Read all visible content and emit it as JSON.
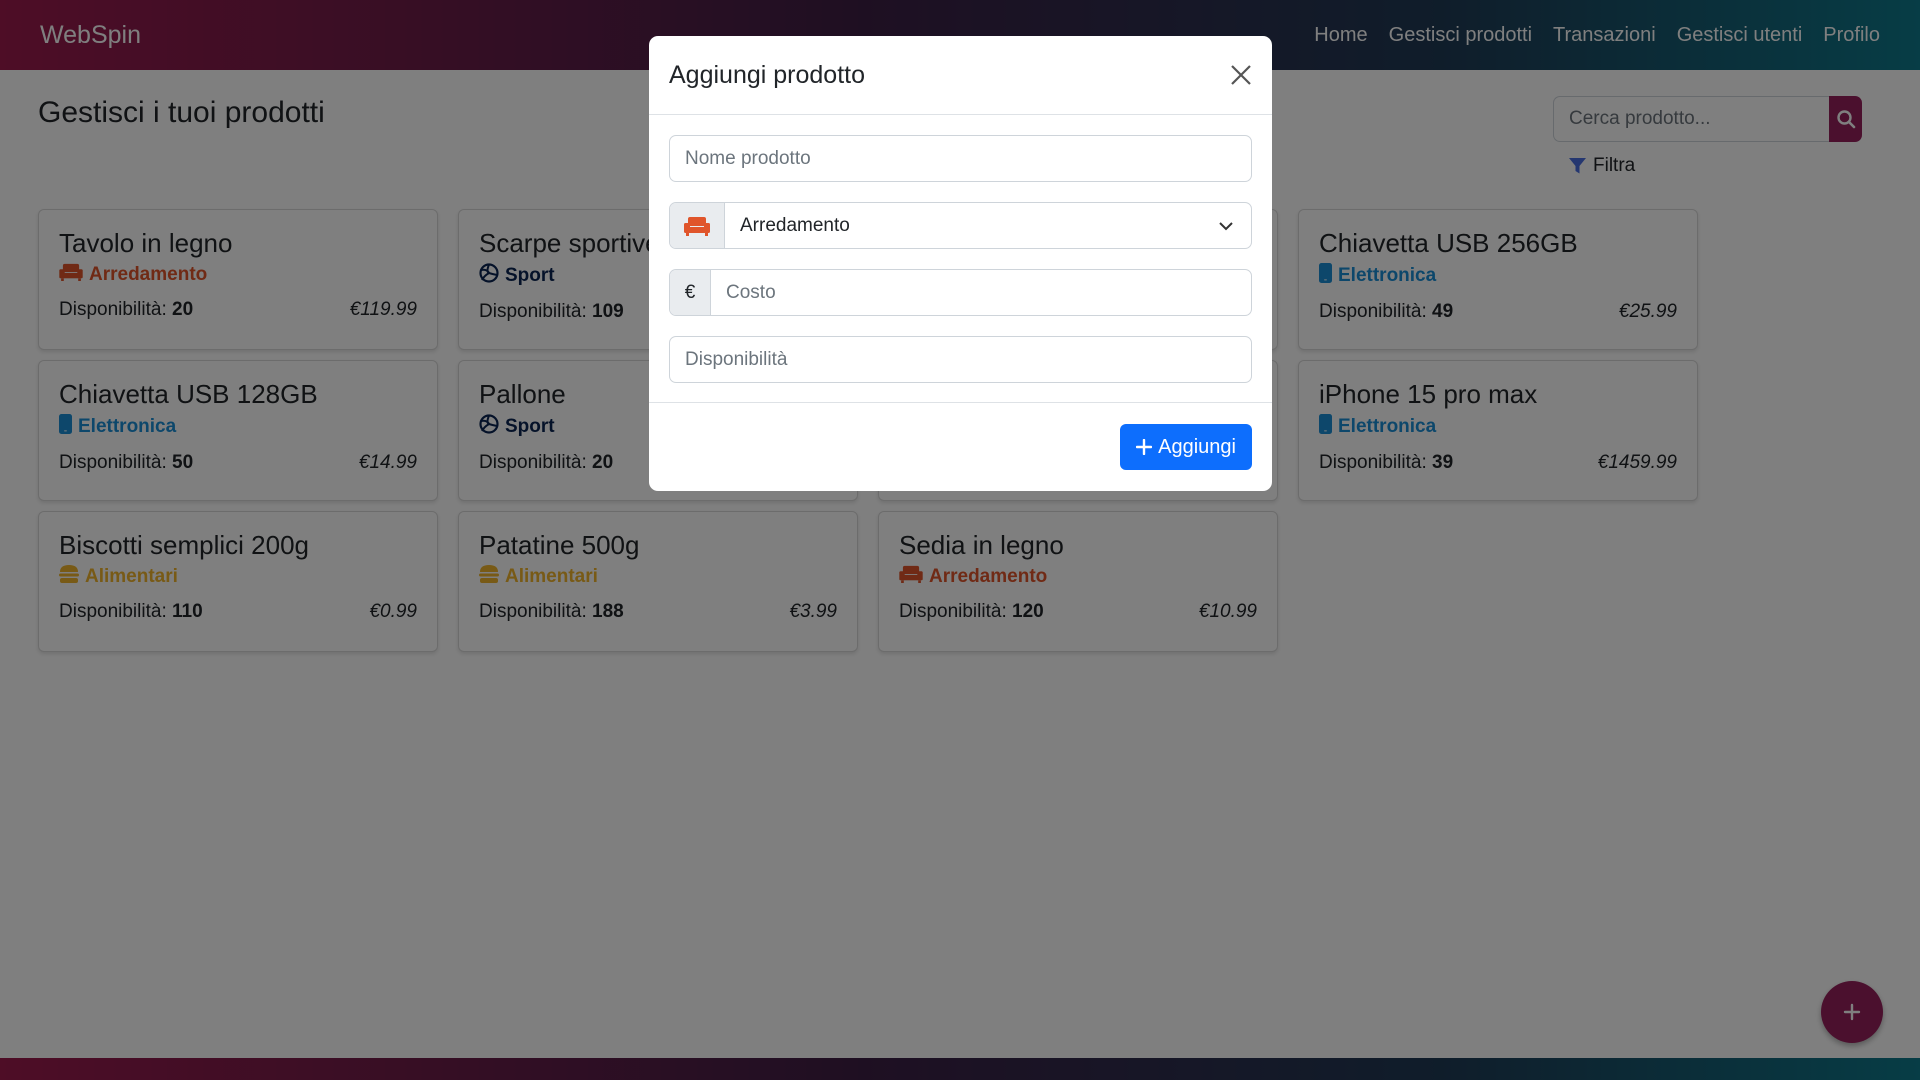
{
  "navbar": {
    "brand": "WebSpin",
    "links": [
      "Home",
      "Gestisci prodotti",
      "Transazioni",
      "Gestisci utenti",
      "Profilo"
    ]
  },
  "page": {
    "title": "Gestisci i tuoi prodotti",
    "search_placeholder": "Cerca prodotto...",
    "filter_label": "Filtra",
    "avail_label": "Disponibilità:"
  },
  "colors": {
    "brand": "#97215d",
    "arredamento": "#e0552b",
    "sport": "#0b2552",
    "elettronica": "#1a8fd6",
    "alimentari": "#f0b52c",
    "primary": "#0d6efd"
  },
  "products": [
    {
      "name": "Tavolo in legno",
      "category": "Arredamento",
      "icon": "couch-icon",
      "availability": "20",
      "price": "€119.99"
    },
    {
      "name": "Scarpe sportive",
      "category": "Sport",
      "icon": "volleyball-icon",
      "availability": "109",
      "price": ""
    },
    {
      "name": "",
      "category": "",
      "icon": "",
      "availability": "",
      "price": ""
    },
    {
      "name": "Chiavetta USB 256GB",
      "category": "Elettronica",
      "icon": "mobile-icon",
      "availability": "49",
      "price": "€25.99"
    },
    {
      "name": "Chiavetta USB 128GB",
      "category": "Elettronica",
      "icon": "mobile-icon",
      "availability": "50",
      "price": "€14.99"
    },
    {
      "name": "Pallone",
      "category": "Sport",
      "icon": "volleyball-icon",
      "availability": "20",
      "price": ""
    },
    {
      "name": "",
      "category": "",
      "icon": "",
      "availability": "",
      "price": ""
    },
    {
      "name": "iPhone 15 pro max",
      "category": "Elettronica",
      "icon": "mobile-icon",
      "availability": "39",
      "price": "€1459.99"
    },
    {
      "name": "Biscotti semplici 200g",
      "category": "Alimentari",
      "icon": "burger-icon",
      "availability": "110",
      "price": "€0.99"
    },
    {
      "name": "Patatine 500g",
      "category": "Alimentari",
      "icon": "burger-icon",
      "availability": "188",
      "price": "€3.99"
    },
    {
      "name": "Sedia in legno",
      "category": "Arredamento",
      "icon": "couch-icon",
      "availability": "120",
      "price": "€10.99"
    }
  ],
  "modal": {
    "title": "Aggiungi prodotto",
    "name_placeholder": "Nome prodotto",
    "category_selected": "Arredamento",
    "currency_symbol": "€",
    "cost_placeholder": "Costo",
    "availability_placeholder": "Disponibilità",
    "submit_label": "Aggiungi"
  }
}
